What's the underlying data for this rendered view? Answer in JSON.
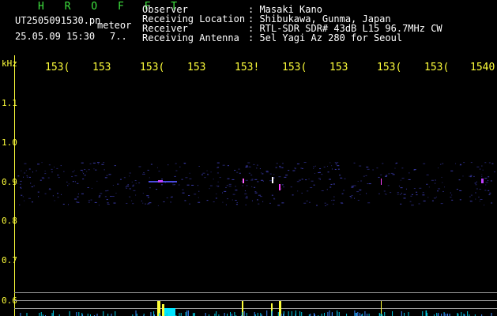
{
  "header": {
    "brand": "H R O F F T",
    "filename": "UT2505091530.pn",
    "type": "meteor",
    "datetime": "25.05.09 15:30",
    "extra": "7..",
    "fields": [
      {
        "label": "Observer",
        "value": ": Masaki Kano"
      },
      {
        "label": "Receiving Location",
        "value": ": Shibukawa, Gunma, Japan"
      },
      {
        "label": "Receiver",
        "value": ": RTL-SDR SDR# 43dB L15 96.7MHz CW"
      },
      {
        "label": "Receiving Antenna",
        "value": ": 5el Yagi Az 280 for Seoul"
      }
    ]
  },
  "axis": {
    "y_unit": "kHz",
    "y_ticks": [
      "1.1",
      "1.0",
      "0.9",
      "0.8",
      "0.7",
      "0.6"
    ],
    "x_ticks": [
      "153(",
      "153",
      "153(",
      "153",
      "153!",
      "153(",
      "153",
      "153(",
      "153(",
      "1540"
    ]
  },
  "colors": {
    "background": "#000000",
    "accent_yellow": "#ffff3a",
    "brand_green": "#3ee33e",
    "grid": "#9a9a9a",
    "echo_cyan": "#00e5ff",
    "noise_blue": "#3a3aa8"
  }
}
